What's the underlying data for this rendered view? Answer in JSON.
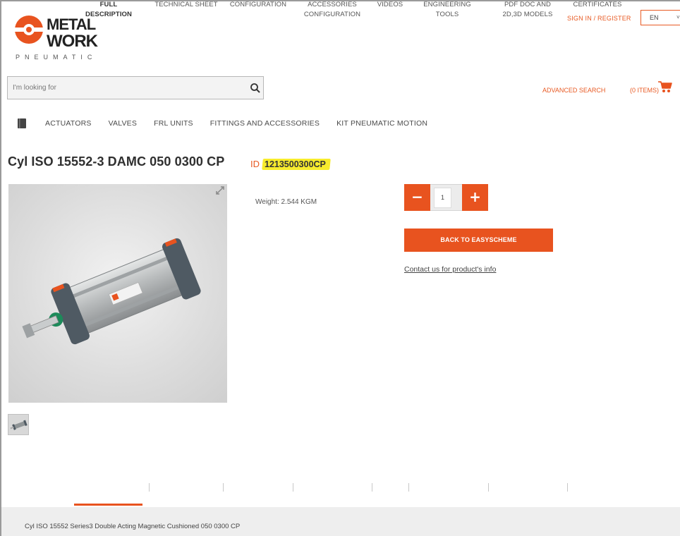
{
  "header": {
    "logo_top": "METAL",
    "logo_bottom": "WORK",
    "logo_sub": "PNEUMATIC",
    "signin": "SIGN IN / REGISTER",
    "lang": "EN",
    "lang_arrow": "˅"
  },
  "search": {
    "placeholder": "I'm looking for",
    "advanced": "ADVANCED SEARCH",
    "cart": "(0 ITEMS)"
  },
  "nav": {
    "items": [
      "ACTUATORS",
      "VALVES",
      "FRL UNITS",
      "FITTINGS AND ACCESSORIES",
      "KIT PNEUMATIC MOTION"
    ]
  },
  "product": {
    "title": "Cyl ISO 15552-3 DAMC 050 0300 CP",
    "id_label": "ID",
    "id": "1213500300CP",
    "weight": "Weight: 2.544 KGM",
    "qty": "1",
    "minus": "−",
    "plus": "+",
    "back": "BACK TO EASYSCHEME",
    "contact": "Contact us for product's info"
  },
  "tabs": [
    {
      "label": "FULL\nDESCRIPTION",
      "active": true
    },
    {
      "label": "TECHNICAL SHEET"
    },
    {
      "label": "CONFIGURATION"
    },
    {
      "label": "ACCESSORIES\nCONFIGURATION"
    },
    {
      "label": "VIDEOS"
    },
    {
      "label": "ENGINEERING\nTOOLS"
    },
    {
      "label": "PDF DOC AND\n2D,3D MODELS"
    },
    {
      "label": "CERTIFICATES"
    }
  ],
  "description": "Cyl ISO 15552 Series3 Double Acting Magnetic Cushioned 050 0300 CP",
  "colors": {
    "accent": "#e8531f",
    "highlight": "#f7ec2d"
  }
}
